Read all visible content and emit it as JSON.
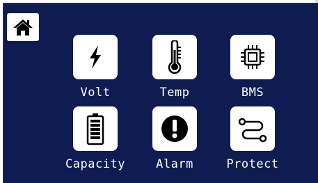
{
  "home": {
    "icon": "home-icon"
  },
  "menu": [
    {
      "label": "Volt",
      "icon": "lightning-bolt-icon"
    },
    {
      "label": "Temp",
      "icon": "thermometer-icon"
    },
    {
      "label": "BMS",
      "icon": "chip-icon"
    },
    {
      "label": "Capacity",
      "icon": "battery-icon"
    },
    {
      "label": "Alarm",
      "icon": "alarm-exclamation-icon"
    },
    {
      "label": "Protect",
      "icon": "protect-path-icon"
    }
  ],
  "colors": {
    "screen_background": "#0f1c52",
    "tile_background": "#ffffff",
    "label_text": "#ffffff",
    "icon_color": "#000000"
  }
}
